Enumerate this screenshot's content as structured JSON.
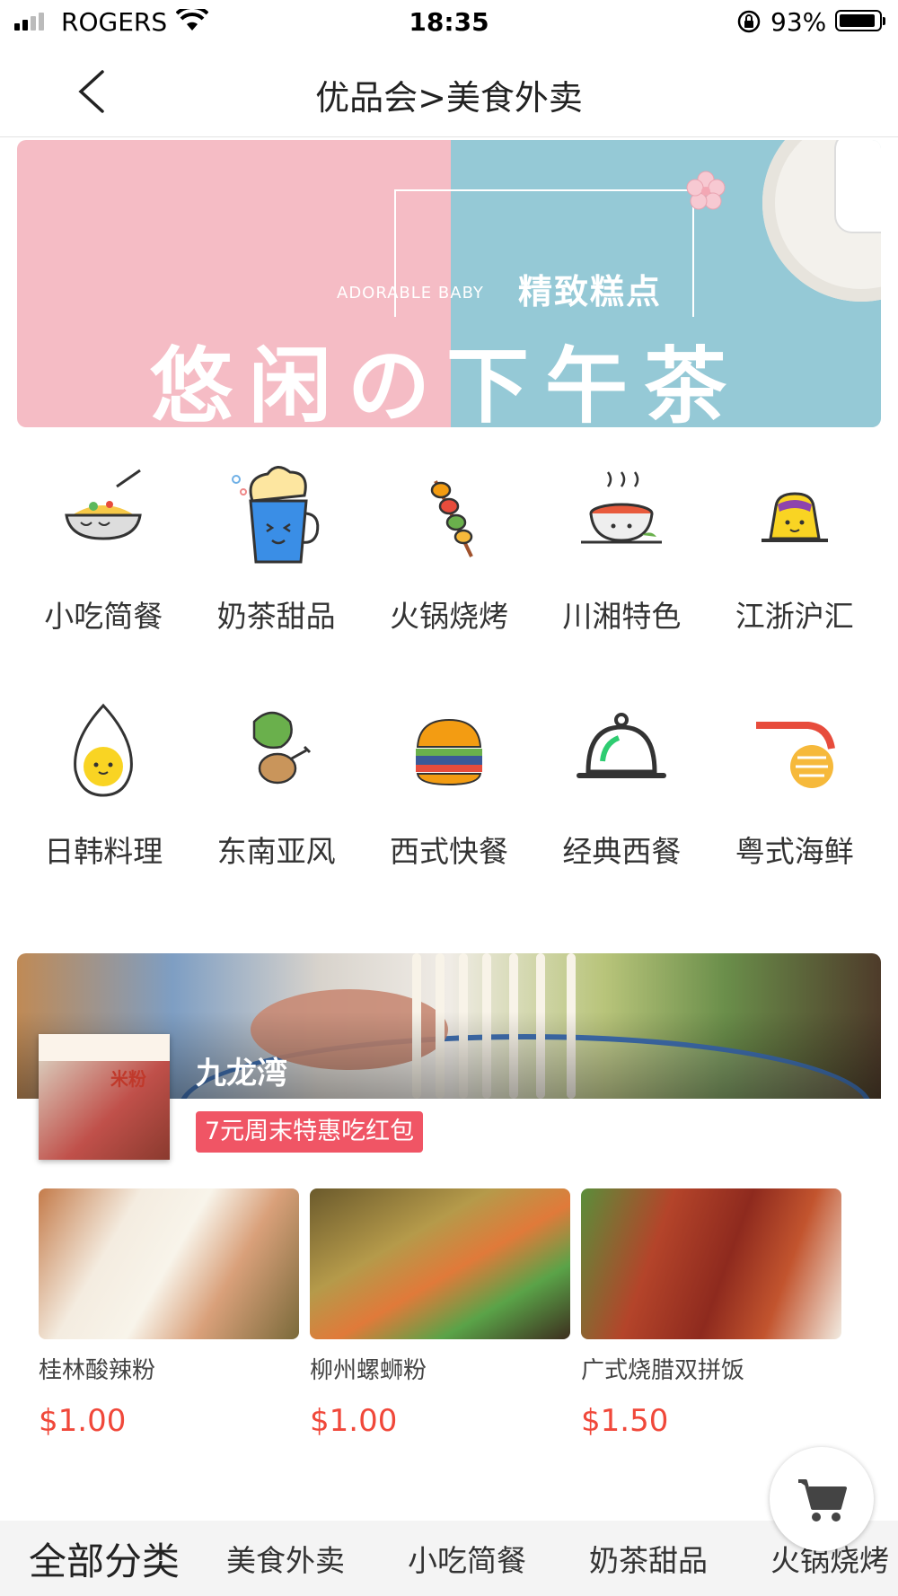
{
  "status_bar": {
    "carrier": "ROGERS",
    "time": "18:35",
    "battery": "93%",
    "battery_level": 0.93
  },
  "header": {
    "title": "优品会>美食外卖",
    "back_icon": "chevron-left-icon"
  },
  "banner": {
    "tagline_en": "ADORABLE BABY",
    "tagline_cn": "精致糕点",
    "headline": "悠闲の下午茶",
    "colors": {
      "left": "#f5bcc5",
      "right": "#95c9d6"
    }
  },
  "categories": [
    {
      "label": "小吃简餐",
      "icon": "noodle-bowl-icon"
    },
    {
      "label": "奶茶甜品",
      "icon": "milk-tea-cup-icon"
    },
    {
      "label": "火锅烧烤",
      "icon": "skewer-icon"
    },
    {
      "label": "川湘特色",
      "icon": "hot-pot-icon"
    },
    {
      "label": "江浙沪汇",
      "icon": "pudding-icon"
    },
    {
      "label": "日韩料理",
      "icon": "egg-icon"
    },
    {
      "label": "东南亚风",
      "icon": "drumstick-icon"
    },
    {
      "label": "西式快餐",
      "icon": "burger-icon"
    },
    {
      "label": "经典西餐",
      "icon": "cloche-icon"
    },
    {
      "label": "粤式海鲜",
      "icon": "shrimp-icon"
    }
  ],
  "restaurant": {
    "name": "九龙湾",
    "promo": "7元周末特惠吃红包",
    "logo_tag": "米粉"
  },
  "dishes": [
    {
      "name": "桂林酸辣粉",
      "price": "$1.00"
    },
    {
      "name": "柳州螺蛳粉",
      "price": "$1.00"
    },
    {
      "name": "广式烧腊双拼饭",
      "price": "$1.50"
    }
  ],
  "cart": {
    "icon": "shopping-cart-icon"
  },
  "bottom_tabs": [
    "全部分类",
    "美食外卖",
    "小吃简餐",
    "奶茶甜品",
    "火锅烧烤"
  ],
  "accent_colors": {
    "price": "#f0483a",
    "promo_badge": "#f05565"
  }
}
